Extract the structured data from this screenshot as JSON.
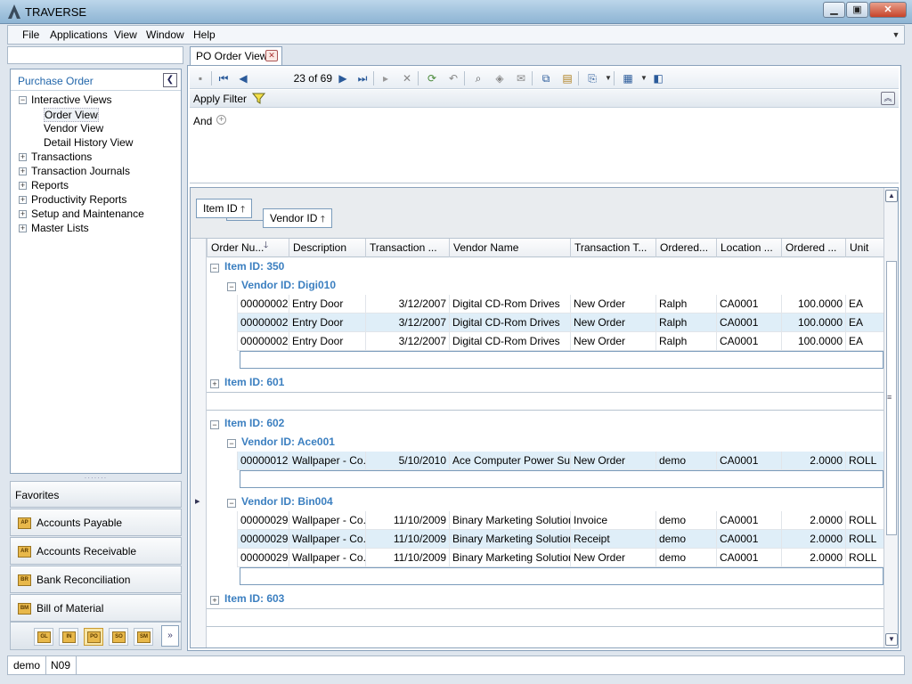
{
  "app": {
    "title": "TRAVERSE"
  },
  "menu": {
    "file": "File",
    "applications": "Applications",
    "view": "View",
    "window": "Window",
    "help": "Help"
  },
  "nav": {
    "title": "Purchase Order",
    "tree": [
      {
        "label": "Interactive Views",
        "toggle": "−",
        "level": 0
      },
      {
        "label": "Order View",
        "level": 1,
        "selected": true
      },
      {
        "label": "Vendor View",
        "level": 1
      },
      {
        "label": "Detail History View",
        "level": 1
      },
      {
        "label": "Transactions",
        "toggle": "+",
        "level": 0
      },
      {
        "label": "Transaction Journals",
        "toggle": "+",
        "level": 0
      },
      {
        "label": "Reports",
        "toggle": "+",
        "level": 0
      },
      {
        "label": "Productivity Reports",
        "toggle": "+",
        "level": 0
      },
      {
        "label": "Setup and Maintenance",
        "toggle": "+",
        "level": 0
      },
      {
        "label": "Master Lists",
        "toggle": "+",
        "level": 0
      }
    ]
  },
  "favorites": {
    "label": "Favorites"
  },
  "modules": [
    {
      "label": "Accounts Payable",
      "icon": "AP"
    },
    {
      "label": "Accounts Receivable",
      "icon": "AR"
    },
    {
      "label": "Bank Reconciliation",
      "icon": "BR"
    },
    {
      "label": "Bill of Material",
      "icon": "BM"
    }
  ],
  "module_shortcuts": [
    "GL",
    "IN",
    "PO",
    "SO",
    "SM"
  ],
  "tab": {
    "label": "PO Order View"
  },
  "toolbar": {
    "record_position": "23 of 69"
  },
  "filter": {
    "label": "Apply Filter",
    "and_label": "And"
  },
  "grid": {
    "group_by": [
      "Item ID",
      "Vendor ID"
    ],
    "columns": [
      "Order Nu...",
      "Description",
      "Transaction ...",
      "Vendor Name",
      "Transaction T...",
      "Ordered...",
      "Location ...",
      "Ordered ...",
      "Unit"
    ],
    "groups": {
      "g350": "Item ID: 350",
      "g350v": "Vendor ID: Digi010",
      "g601": "Item ID: 601",
      "g602": "Item ID: 602",
      "g602v1": "Vendor ID: Ace001",
      "g602v2": "Vendor ID: Bin004",
      "g603": "Item ID: 603"
    },
    "rows": [
      [
        "00000002",
        "Entry Door",
        "3/12/2007",
        "Digital CD-Rom Drives",
        "New Order",
        "Ralph",
        "CA0001",
        "100.0000",
        "EA"
      ],
      [
        "00000002",
        "Entry Door",
        "3/12/2007",
        "Digital CD-Rom Drives",
        "New Order",
        "Ralph",
        "CA0001",
        "100.0000",
        "EA"
      ],
      [
        "00000002",
        "Entry Door",
        "3/12/2007",
        "Digital CD-Rom Drives",
        "New Order",
        "Ralph",
        "CA0001",
        "100.0000",
        "EA"
      ],
      [
        "00000012",
        "Wallpaper - Co...",
        "5/10/2010",
        "Ace Computer Power Su...",
        "New Order",
        "demo",
        "CA0001",
        "2.0000",
        "ROLL"
      ],
      [
        "00000029",
        "Wallpaper - Co...",
        "11/10/2009",
        "Binary Marketing Solutions",
        "Invoice",
        "demo",
        "CA0001",
        "2.0000",
        "ROLL"
      ],
      [
        "00000029",
        "Wallpaper - Co...",
        "11/10/2009",
        "Binary Marketing Solutions",
        "Receipt",
        "demo",
        "CA0001",
        "2.0000",
        "ROLL"
      ],
      [
        "00000029",
        "Wallpaper - Co...",
        "11/10/2009",
        "Binary Marketing Solutions",
        "New Order",
        "demo",
        "CA0001",
        "2.0000",
        "ROLL"
      ]
    ]
  },
  "status": {
    "user": "demo",
    "company": "N09"
  }
}
